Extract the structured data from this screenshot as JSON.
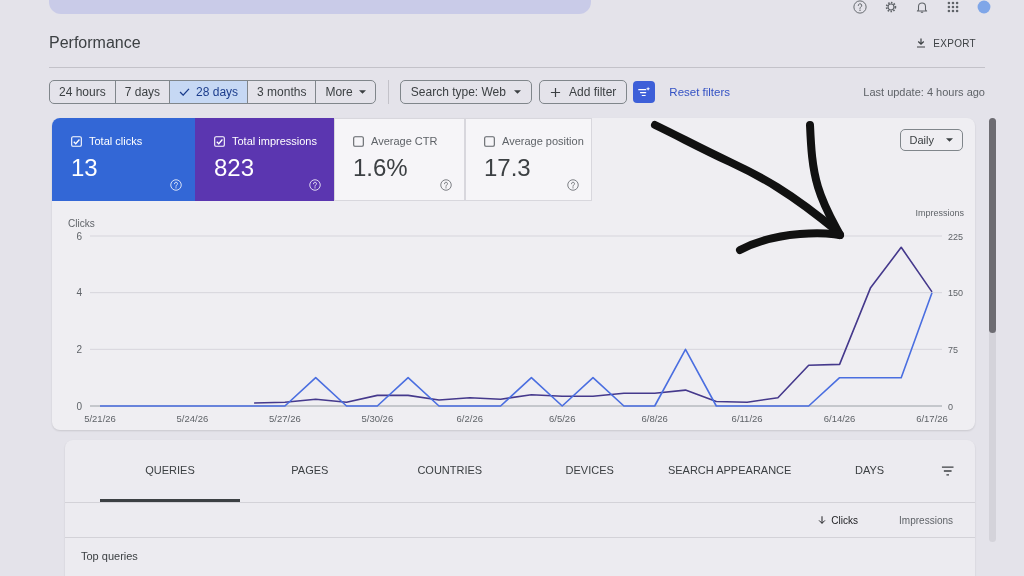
{
  "header": {
    "title": "Performance",
    "export_button": "EXPORT"
  },
  "filters": {
    "date_ranges": [
      {
        "label": "24 hours",
        "kind": "option",
        "selected": false
      },
      {
        "label": "7 days",
        "kind": "option",
        "selected": false
      },
      {
        "label": "28 days",
        "kind": "option",
        "selected": true
      },
      {
        "label": "3 months",
        "kind": "option",
        "selected": false
      },
      {
        "label": "More",
        "kind": "menu",
        "selected": false
      }
    ],
    "search_type": "Search type: Web",
    "add_filter": "Add filter",
    "reset_filters": "Reset filters",
    "last_update": "Last update: 4 hours ago"
  },
  "chart_card": {
    "metrics": [
      {
        "label": "Total clicks",
        "value": "13",
        "checked": true,
        "color": "#3367d6"
      },
      {
        "label": "Total impressions",
        "value": "823",
        "checked": true,
        "color": "#5b36b0"
      },
      {
        "label": "Average CTR",
        "value": "1.6%",
        "checked": false
      },
      {
        "label": "Average position",
        "value": "17.3",
        "checked": false
      }
    ],
    "granularity": "Daily",
    "chart_data": {
      "type": "line",
      "ylabel": "Clicks",
      "y2label": "Impressions",
      "categories": [
        "5/21/26",
        null,
        null,
        "5/24/26",
        null,
        null,
        "5/27/26",
        null,
        null,
        "5/30/26",
        null,
        null,
        "6/2/26",
        null,
        null,
        "6/5/26",
        null,
        null,
        "6/8/26",
        null,
        null,
        "6/11/26",
        null,
        null,
        "6/14/26",
        null,
        null,
        "6/17/26"
      ],
      "ylim": [
        0,
        6
      ],
      "yticks": [
        0,
        2,
        4,
        6
      ],
      "y2lim": [
        0,
        225
      ],
      "y2ticks": [
        0,
        75,
        150,
        225
      ],
      "series": [
        {
          "axis": "y2",
          "color": "#45398c",
          "values": [
            null,
            null,
            null,
            null,
            null,
            4,
            5,
            9,
            5,
            14,
            14,
            8,
            11,
            9,
            15,
            13,
            13,
            17,
            17,
            21,
            6,
            5,
            11,
            54,
            55,
            156,
            210,
            151
          ]
        },
        {
          "color": "#4a6ee0",
          "values": [
            0,
            0,
            0,
            0,
            0,
            0,
            0,
            1,
            0,
            0,
            1,
            0,
            0,
            0,
            1,
            0,
            1,
            0,
            0,
            2,
            0,
            0,
            0,
            0,
            1,
            1,
            1,
            4
          ]
        }
      ]
    }
  },
  "tabs": [
    {
      "label": "QUERIES",
      "selected": true
    },
    {
      "label": "PAGES",
      "selected": false
    },
    {
      "label": "COUNTRIES",
      "selected": false
    },
    {
      "label": "DEVICES",
      "selected": false
    },
    {
      "label": "SEARCH APPEARANCE",
      "selected": false
    },
    {
      "label": "DAYS",
      "selected": false
    }
  ],
  "table": {
    "columns": [
      {
        "label": "Clicks",
        "sorted": true
      },
      {
        "label": "Impressions",
        "sorted": false
      }
    ],
    "title": "Top queries"
  }
}
